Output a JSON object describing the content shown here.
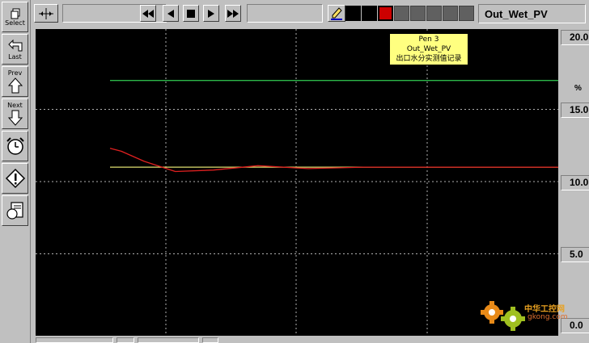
{
  "left_toolbar": {
    "select_label": "Select",
    "last_label": "Last",
    "prev_label": "Prev",
    "next_label": "Next"
  },
  "top_toolbar": {
    "tag_name": "Out_Wet_PV",
    "swatches": [
      "#000000",
      "#000000",
      "#cc0000",
      "#606060",
      "#606060",
      "#606060",
      "#606060",
      "#606060"
    ]
  },
  "tooltip": {
    "line1": "Pen 3",
    "line2": "Out_Wet_PV",
    "line3": "出口水分实测值记录"
  },
  "scale": {
    "unit": "%",
    "ticks": [
      "20.0",
      "15.0",
      "10.0",
      "5.0",
      "0.0"
    ]
  },
  "chart_data": {
    "type": "line",
    "ylim": [
      0,
      20
    ],
    "series": [
      {
        "color": "#2db84a",
        "values": [
          17.0,
          17.0
        ]
      },
      {
        "color": "#e0e070",
        "values": [
          11.0,
          11.0
        ]
      },
      {
        "color": "#e02020",
        "values": [
          12.3,
          12.1,
          11.4,
          10.7,
          10.8,
          11.1,
          10.9,
          11.0,
          11.0,
          11.0,
          11.0
        ]
      }
    ]
  },
  "watermark": {
    "text": "中华工控网",
    "url": "gkong.com"
  }
}
